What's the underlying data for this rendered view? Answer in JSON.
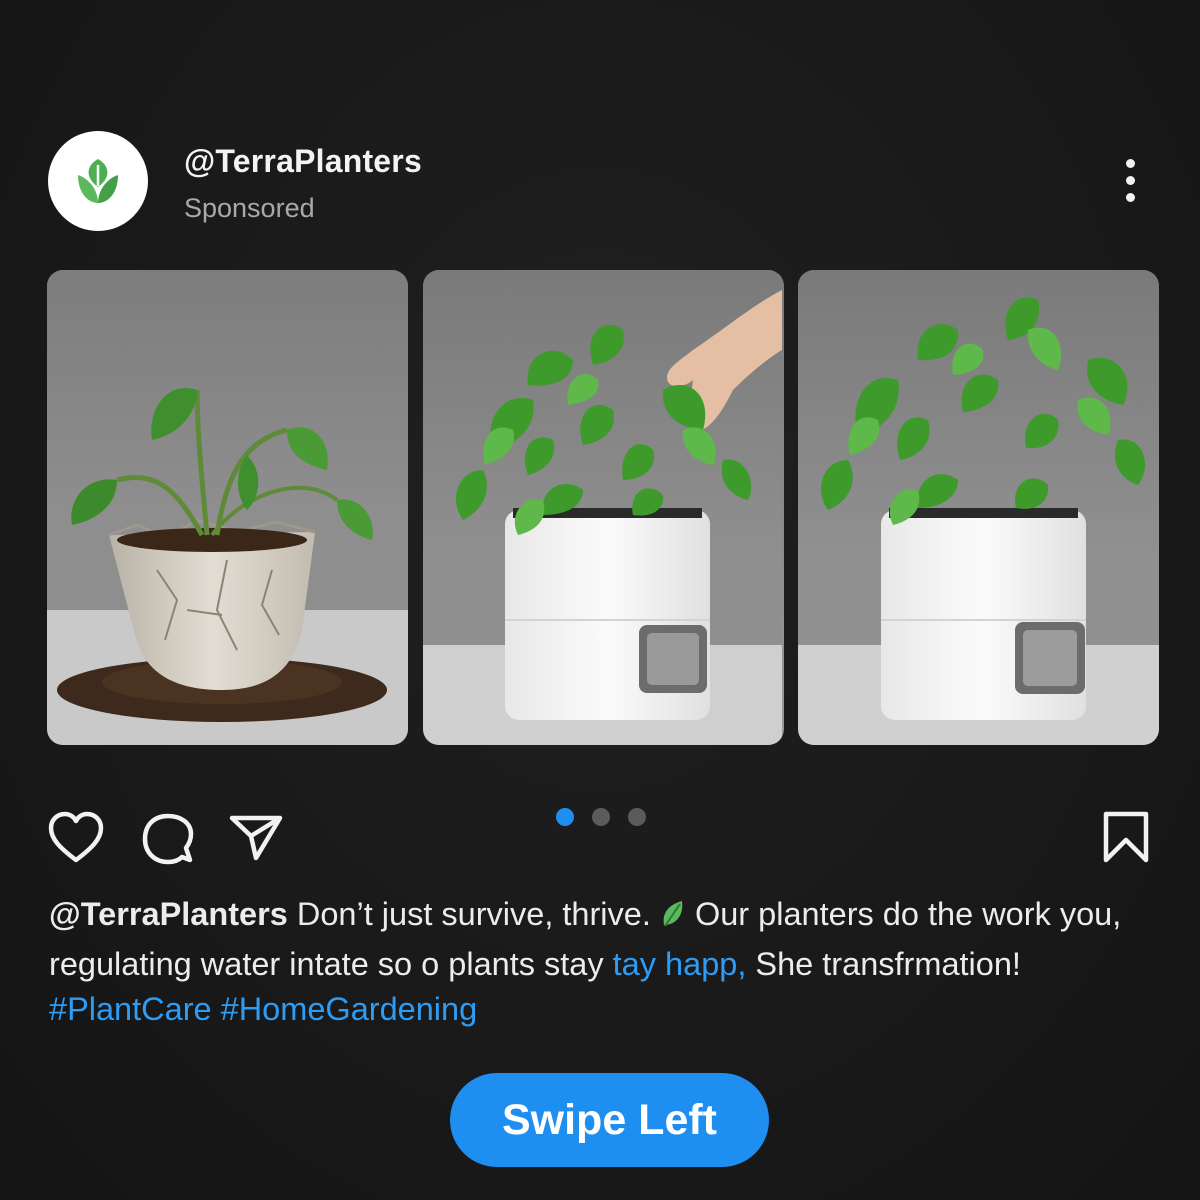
{
  "post": {
    "handle": "@TerraPlanters",
    "sponsored_label": "Sponsored",
    "avatar_icon": "leaf-logo-icon"
  },
  "carousel": {
    "slides": [
      {
        "subject": "wilted plant in cracked pot"
      },
      {
        "subject": "hand touching healthy plant in white self-watering planter"
      },
      {
        "subject": "healthy plant in white self-watering planter"
      }
    ],
    "page_count": 3,
    "active_index": 0
  },
  "actions": {
    "like_icon": "heart-icon",
    "comment_icon": "comment-bubble-icon",
    "share_icon": "send-icon",
    "save_icon": "bookmark-icon"
  },
  "caption": {
    "handle": "@TerraPlanters",
    "text_1": " Don’t just survive, thrive. ",
    "text_2": " Our planters do the work you, regulating water intate so o plants stay ",
    "link_text": "tay happ,",
    "text_3": " She transfrmation!",
    "hashtag_1": "#PlantCare",
    "hashtag_2": "#HomeGardening"
  },
  "cta": {
    "label": "Swipe Left"
  },
  "colors": {
    "accent": "#1e8ff0",
    "link": "#2c9cf5",
    "background": "#1a1a1b",
    "logo_green": "#4caf50"
  }
}
